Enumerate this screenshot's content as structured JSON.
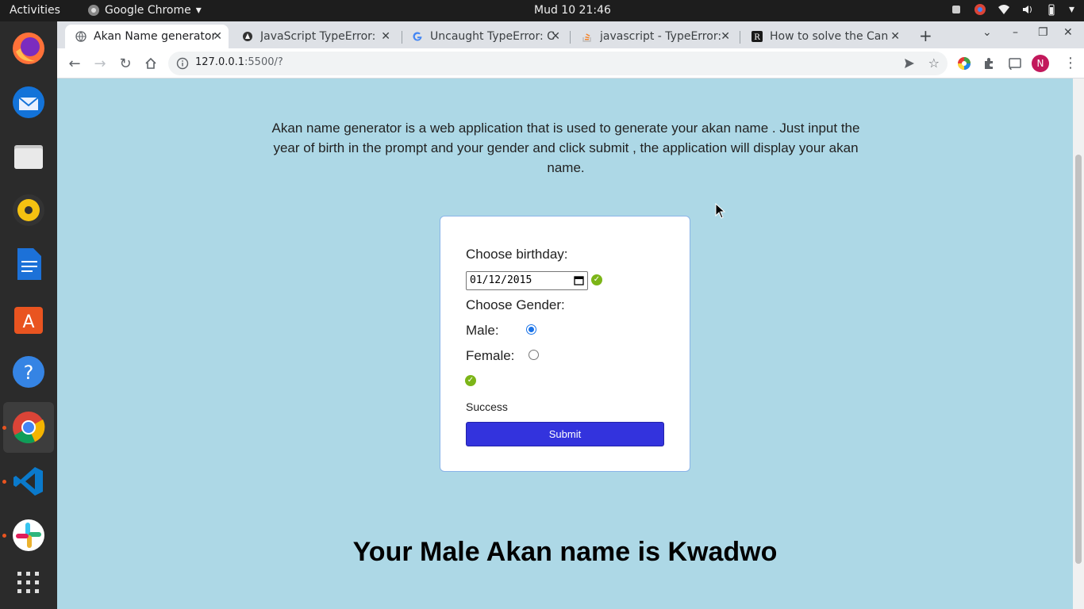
{
  "system": {
    "activities": "Activities",
    "app_name": "Google Chrome",
    "clock": "Mud 10  21:46"
  },
  "browser": {
    "tabs": [
      {
        "title": "Akan Name generator",
        "active": true,
        "favicon": "globe-icon"
      },
      {
        "title": "JavaScript TypeError:",
        "active": false,
        "favicon": "mdn-icon"
      },
      {
        "title": "Uncaught TypeError: C",
        "active": false,
        "favicon": "google-icon"
      },
      {
        "title": "javascript - TypeError:",
        "active": false,
        "favicon": "stackoverflow-icon"
      },
      {
        "title": "How to solve the Can",
        "active": false,
        "favicon": "rollbar-icon"
      }
    ],
    "url_host": "127.0.0.1",
    "url_path": ":5500/?",
    "profile_initial": "N"
  },
  "page": {
    "intro": "Akan name generator is a web application that is used to generate your akan name . Just input the year of birth in the prompt and your gender and click submit , the application will display your akan name.",
    "form": {
      "birthday_label": "Choose birthday:",
      "birthday_value": "01/12/2015",
      "gender_label": "Choose Gender:",
      "male_label": "Male:",
      "female_label": "Female:",
      "male_checked": true,
      "success_text": "Success",
      "submit_label": "Submit"
    },
    "result": "Your Male Akan name is Kwadwo"
  },
  "colors": {
    "page_bg": "#add8e6",
    "submit_bg": "#3333dd",
    "check": "#7cb518"
  }
}
